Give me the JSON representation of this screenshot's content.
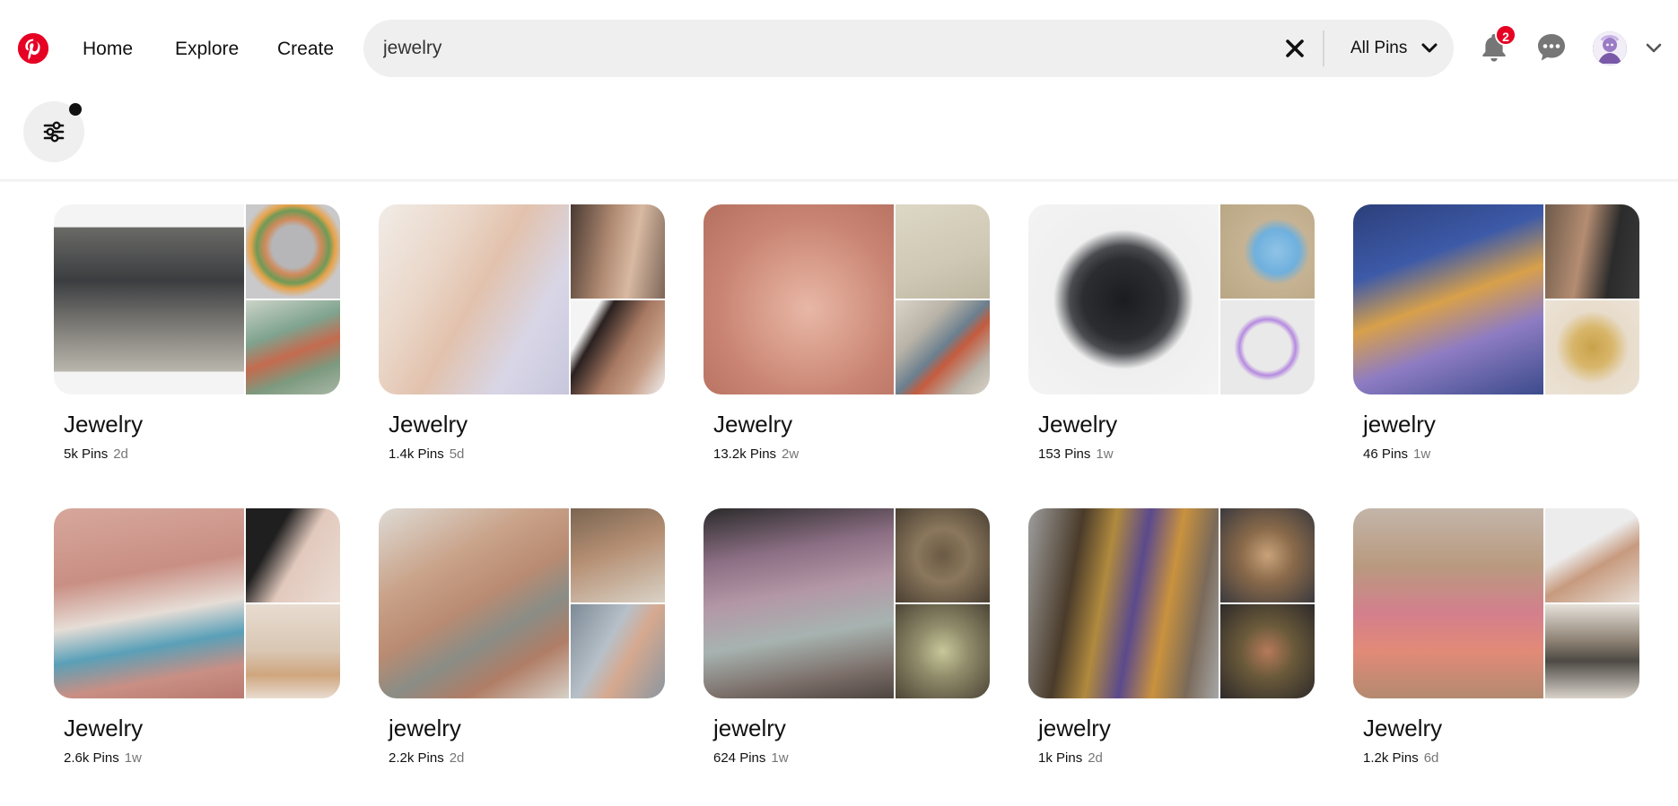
{
  "nav": {
    "home": "Home",
    "explore": "Explore",
    "create": "Create"
  },
  "search": {
    "value": "jewelry",
    "scope": "All Pins"
  },
  "notifications": {
    "count": "2"
  },
  "colors": {
    "brand": "#e60023",
    "search_bg": "#efefef",
    "muted_text": "#767676"
  },
  "icons": [
    "pinterest-logo-icon",
    "clear-icon",
    "chevron-down-icon",
    "bell-icon",
    "chat-icon",
    "filter-icon"
  ],
  "boards": [
    {
      "title": "Jewelry",
      "pins": "5k Pins",
      "age": "2d"
    },
    {
      "title": "Jewelry",
      "pins": "1.4k Pins",
      "age": "5d"
    },
    {
      "title": "Jewelry",
      "pins": "13.2k Pins",
      "age": "2w"
    },
    {
      "title": "Jewelry",
      "pins": "153 Pins",
      "age": "1w"
    },
    {
      "title": "jewelry",
      "pins": "46 Pins",
      "age": "1w"
    },
    {
      "title": "Jewelry",
      "pins": "2.6k Pins",
      "age": "1w"
    },
    {
      "title": "jewelry",
      "pins": "2.2k Pins",
      "age": "2d"
    },
    {
      "title": "jewelry",
      "pins": "624 Pins",
      "age": "1w"
    },
    {
      "title": "jewelry",
      "pins": "1k Pins",
      "age": "2d"
    },
    {
      "title": "Jewelry",
      "pins": "1.2k Pins",
      "age": "6d"
    }
  ]
}
